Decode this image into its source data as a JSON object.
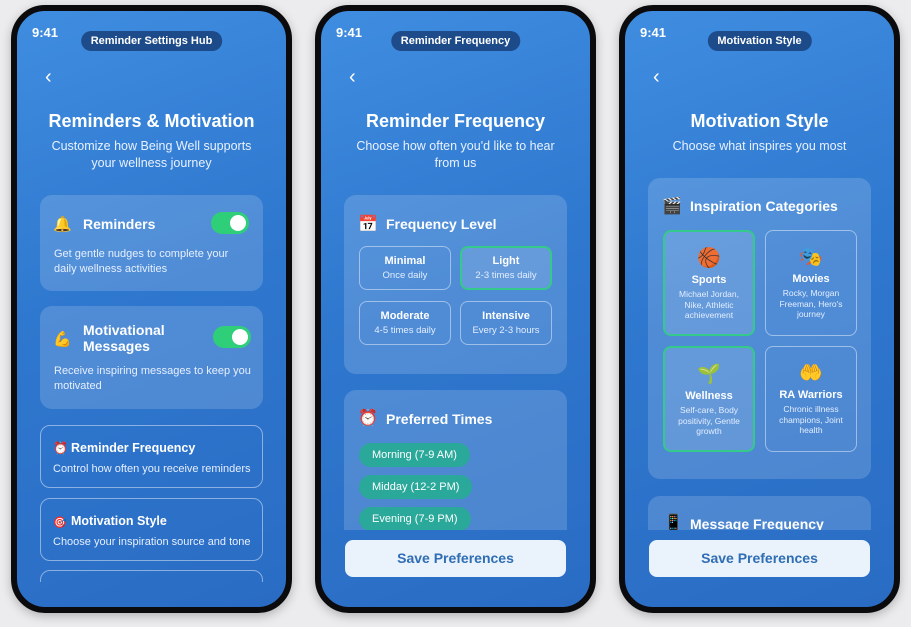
{
  "phone1": {
    "time": "9:41",
    "pill": "Reminder Settings Hub",
    "back": "‹",
    "title": "Reminders & Motivation",
    "subtitle": "Customize how Being Well supports your wellness journey",
    "reminders": {
      "icon": "🔔",
      "label": "Reminders",
      "desc": "Get gentle nudges to complete your daily wellness activities",
      "enabled": true
    },
    "motivational": {
      "icon": "💪",
      "label": "Motivational Messages",
      "desc": "Receive inspiring messages to keep you motivated",
      "enabled": true
    },
    "frequency_link": {
      "icon": "⏰",
      "label": "Reminder Frequency",
      "desc": "Control how often you receive reminders"
    },
    "style_link": {
      "icon": "🎯",
      "label": "Motivation Style",
      "desc": "Choose your inspiration source and tone"
    }
  },
  "phone2": {
    "time": "9:41",
    "pill": "Reminder Frequency",
    "back": "‹",
    "title": "Reminder Frequency",
    "subtitle": "Choose how often you'd like to hear from us",
    "level": {
      "icon": "📅",
      "heading": "Frequency Level",
      "options": [
        {
          "label": "Minimal",
          "desc": "Once daily",
          "selected": false
        },
        {
          "label": "Light",
          "desc": "2-3 times daily",
          "selected": true
        },
        {
          "label": "Moderate",
          "desc": "4-5 times daily",
          "selected": false
        },
        {
          "label": "Intensive",
          "desc": "Every 2-3 hours",
          "selected": false
        }
      ]
    },
    "times": {
      "icon": "⏰",
      "heading": "Preferred Times",
      "chips": [
        "Morning (7-9 AM)",
        "Midday (12-2 PM)",
        "Evening (7-9 PM)"
      ]
    },
    "save_label": "Save Preferences"
  },
  "phone3": {
    "time": "9:41",
    "pill": "Motivation Style",
    "back": "‹",
    "title": "Motivation Style",
    "subtitle": "Choose what inspires you most",
    "categories": {
      "icon": "🎬",
      "heading": "Inspiration Categories",
      "items": [
        {
          "icon": "🏀",
          "name": "Sports",
          "desc": "Michael Jordan, Nike, Athletic achievement",
          "selected": true
        },
        {
          "icon": "🎭",
          "name": "Movies",
          "desc": "Rocky, Morgan Freeman, Hero's journey",
          "selected": false
        },
        {
          "icon": "🌱",
          "name": "Wellness",
          "desc": "Self-care, Body positivity, Gentle growth",
          "selected": true
        },
        {
          "icon": "🤲",
          "name": "RA Warriors",
          "desc": "Chronic illness champions, Joint health",
          "selected": false
        }
      ]
    },
    "message_frequency": {
      "icon": "📱",
      "heading": "Message Frequency"
    },
    "save_label": "Save Preferences"
  },
  "colors": {
    "toggle_on": "#2fcf7a",
    "selected_border": "#35c98b",
    "chip": "#2aa89a",
    "save_text": "#2f6db4"
  }
}
